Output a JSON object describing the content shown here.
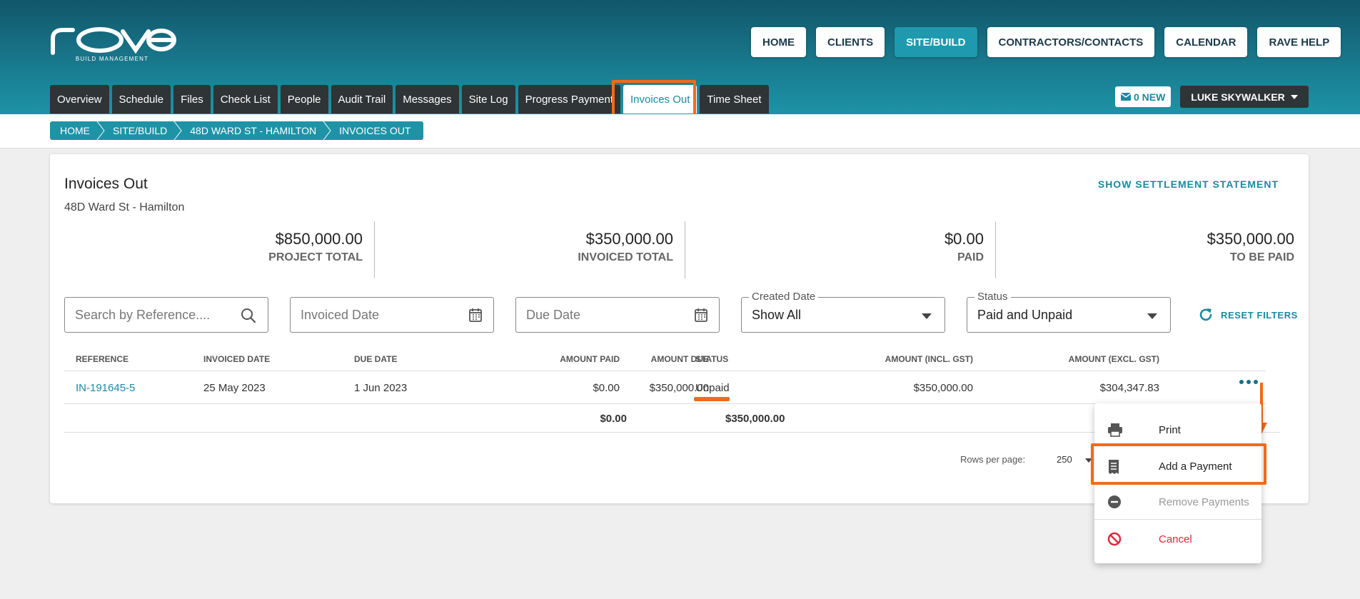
{
  "logo": {
    "subtitle": "BUILD MANAGEMENT"
  },
  "topnav": [
    "HOME",
    "CLIENTS",
    "SITE/BUILD",
    "CONTRACTORS/CONTACTS",
    "CALENDAR",
    "RAVE HELP"
  ],
  "tabs": [
    "Overview",
    "Schedule",
    "Files",
    "Check List",
    "People",
    "Audit Trail",
    "Messages",
    "Site Log",
    "Progress Payment",
    "Invoices Out",
    "Time Sheet"
  ],
  "messages": {
    "label": "0 NEW"
  },
  "user": {
    "name": "LUKE SKYWALKER"
  },
  "breadcrumb": [
    "HOME",
    "SITE/BUILD",
    "48D WARD ST - HAMILTON",
    "INVOICES OUT"
  ],
  "page": {
    "title": "Invoices Out",
    "subtitle": "48D Ward St - Hamilton",
    "settlement_link": "SHOW SETTLEMENT STATEMENT"
  },
  "totals": [
    {
      "amount": "$850,000.00",
      "label": "PROJECT TOTAL"
    },
    {
      "amount": "$350,000.00",
      "label": "INVOICED TOTAL"
    },
    {
      "amount": "$0.00",
      "label": "PAID"
    },
    {
      "amount": "$350,000.00",
      "label": "TO BE PAID"
    }
  ],
  "filters": {
    "search_placeholder": "Search by Reference....",
    "invoiced_date_placeholder": "Invoiced Date",
    "due_date_placeholder": "Due Date",
    "created_date_label": "Created Date",
    "created_date_value": "Show All",
    "status_label": "Status",
    "status_value": "Paid and Unpaid",
    "reset_label": "RESET FILTERS"
  },
  "table": {
    "headers": [
      "REFERENCE",
      "INVOICED DATE",
      "DUE DATE",
      "AMOUNT PAID",
      "AMOUNT DUE",
      "STATUS",
      "AMOUNT (INCL. GST)",
      "AMOUNT (EXCL. GST)"
    ],
    "rows": [
      {
        "reference": "IN-191645-5",
        "invoiced": "25 May 2023",
        "due": "1 Jun 2023",
        "paid": "$0.00",
        "amount_due": "$350,000.00",
        "status": "Unpaid",
        "incl": "$350,000.00",
        "excl": "$304,347.83"
      }
    ],
    "footer": {
      "paid": "$0.00",
      "amount_due": "$350,000.00"
    }
  },
  "pagination": {
    "rows_label": "Rows per page:",
    "rows_value": "250"
  },
  "menu": [
    "Print",
    "Add a Payment",
    "Remove Payments",
    "Cancel"
  ],
  "colors": {
    "accent": "#1a8aa0",
    "highlight": "#f26a1b",
    "danger": "#e2253a",
    "dark": "#2f3436"
  }
}
